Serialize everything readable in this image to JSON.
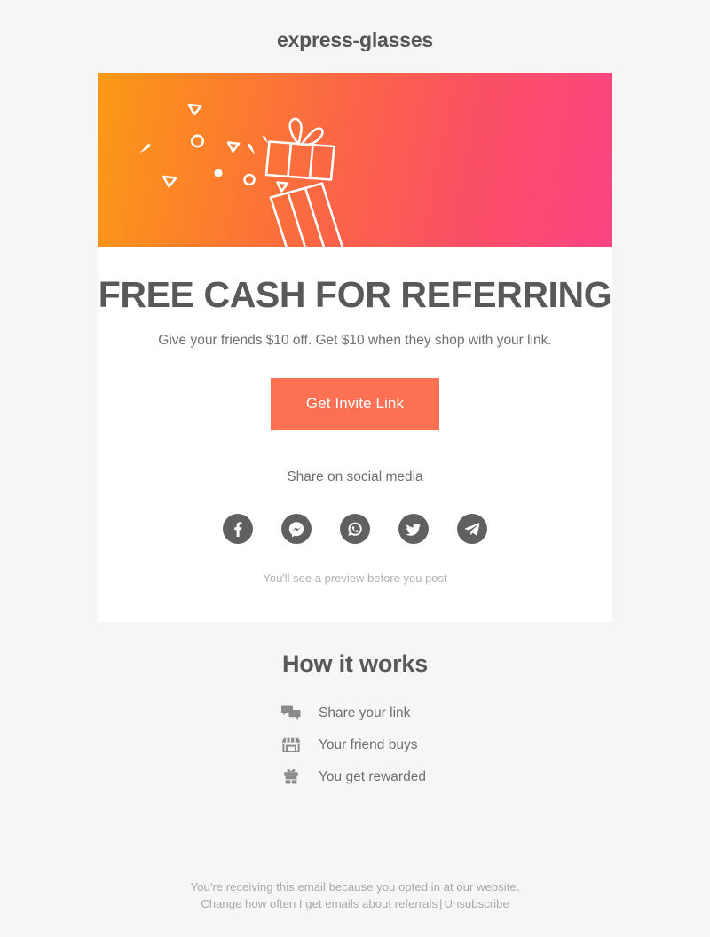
{
  "brand": {
    "title": "express-glasses"
  },
  "hero": {
    "icon": "gift-box-confetti-illustration",
    "gradient_from": "#fb9a16",
    "gradient_to": "#fb4483"
  },
  "main": {
    "headline": "FREE CASH FOR REFERRING",
    "subhead": "Give your friends $10 off. Get $10 when they shop with your link.",
    "cta_label": "Get Invite Link",
    "cta_color": "#fc7053",
    "share_label": "Share on social media",
    "preview_note": "You'll see a preview before you post",
    "social": [
      {
        "name": "facebook",
        "icon": "facebook-icon"
      },
      {
        "name": "messenger",
        "icon": "messenger-icon"
      },
      {
        "name": "whatsapp",
        "icon": "whatsapp-icon"
      },
      {
        "name": "twitter",
        "icon": "twitter-icon"
      },
      {
        "name": "telegram",
        "icon": "telegram-icon"
      }
    ]
  },
  "how_it_works": {
    "title": "How it works",
    "steps": [
      {
        "icon": "chat-bubbles-icon",
        "label": "Share your link"
      },
      {
        "icon": "storefront-icon",
        "label": "Your friend buys"
      },
      {
        "icon": "gift-icon",
        "label": "You get rewarded"
      }
    ]
  },
  "footer": {
    "notice": "You're receiving this email because you opted in at our website.",
    "preferences_link": "Change how often I get emails about referrals",
    "separator": "|",
    "unsubscribe_link": "Unsubscribe"
  }
}
